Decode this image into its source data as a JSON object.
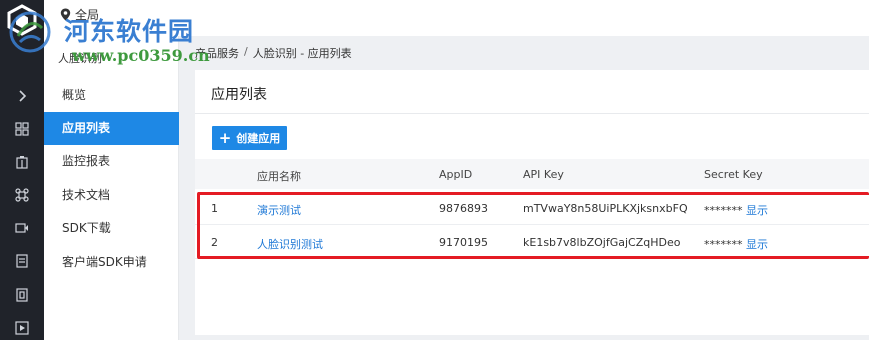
{
  "topbar": {
    "location_label": "全局"
  },
  "watermark": {
    "site_name": "河东软件园",
    "site_url": "www.pc0359.cn"
  },
  "sidebar": {
    "title": "人脸识别",
    "items": [
      {
        "label": "概览"
      },
      {
        "label": "应用列表"
      },
      {
        "label": "监控报表"
      },
      {
        "label": "技术文档"
      },
      {
        "label": "SDK下载"
      },
      {
        "label": "客户端SDK申请"
      }
    ]
  },
  "breadcrumb": {
    "items": [
      "产品服务",
      "人脸识别 - 应用列表"
    ],
    "separator": "/"
  },
  "main": {
    "title": "应用列表",
    "create_button_label": "创建应用",
    "table": {
      "headers": [
        "应用名称",
        "AppID",
        "API Key",
        "Secret Key"
      ],
      "rows": [
        {
          "index": "1",
          "name": "演示测试",
          "app_id": "9876893",
          "api_key": "mTVwaY8n58UiPLKXjksnxbFQ",
          "secret_mask": "*******",
          "show_label": "显示"
        },
        {
          "index": "2",
          "name": "人脸识别测试",
          "app_id": "9170195",
          "api_key": "kE1sb7v8lbZOjfGajCZqHDeo",
          "secret_mask": "*******",
          "show_label": "显示"
        }
      ]
    }
  },
  "colors": {
    "accent": "#1e88e5",
    "rail": "#20232a",
    "highlight": "#e41b23"
  }
}
